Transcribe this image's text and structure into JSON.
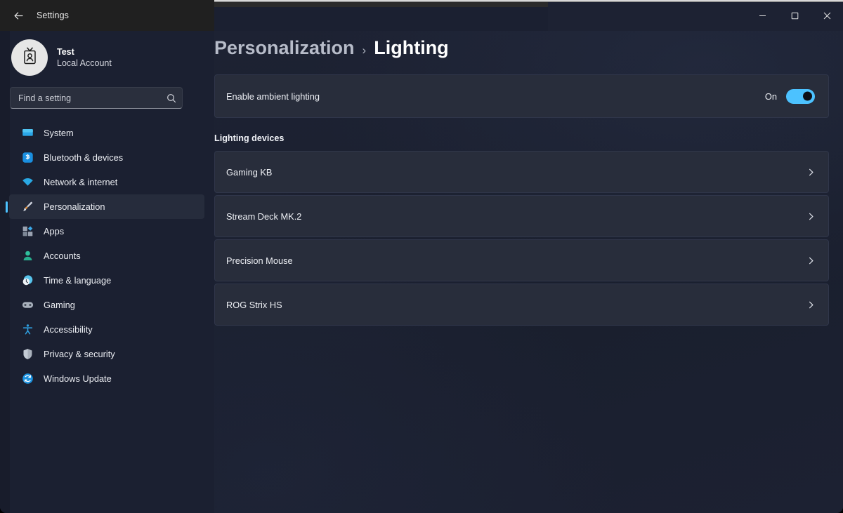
{
  "window": {
    "title": "Settings",
    "back_icon": "arrow-left-icon",
    "caption": {
      "minimize_label": "Minimize",
      "maximize_label": "Maximize",
      "close_label": "Close"
    }
  },
  "account": {
    "name": "Test",
    "type": "Local Account",
    "avatar_icon": "account-badge-icon"
  },
  "search": {
    "placeholder": "Find a setting",
    "value": "",
    "icon": "search-icon"
  },
  "sidebar": {
    "items": [
      {
        "label": "System",
        "icon": "monitor-icon",
        "selected": false
      },
      {
        "label": "Bluetooth & devices",
        "icon": "bluetooth-icon",
        "selected": false
      },
      {
        "label": "Network & internet",
        "icon": "wifi-icon",
        "selected": false
      },
      {
        "label": "Personalization",
        "icon": "paintbrush-icon",
        "selected": true
      },
      {
        "label": "Apps",
        "icon": "apps-icon",
        "selected": false
      },
      {
        "label": "Accounts",
        "icon": "person-icon",
        "selected": false
      },
      {
        "label": "Time & language",
        "icon": "clock-globe-icon",
        "selected": false
      },
      {
        "label": "Gaming",
        "icon": "gamepad-icon",
        "selected": false
      },
      {
        "label": "Accessibility",
        "icon": "accessibility-icon",
        "selected": false
      },
      {
        "label": "Privacy & security",
        "icon": "shield-icon",
        "selected": false
      },
      {
        "label": "Windows Update",
        "icon": "update-icon",
        "selected": false
      }
    ]
  },
  "breadcrumb": {
    "root": "Personalization",
    "separator": "›",
    "current": "Lighting"
  },
  "ambient_lighting": {
    "label": "Enable ambient lighting",
    "state_label": "On",
    "enabled": true
  },
  "devices_section": {
    "heading": "Lighting devices",
    "chevron_icon": "chevron-right-icon",
    "items": [
      {
        "name": "Gaming KB"
      },
      {
        "name": "Stream Deck MK.2"
      },
      {
        "name": "Precision Mouse"
      },
      {
        "name": "ROG Strix HS"
      }
    ]
  },
  "colors": {
    "accent": "#4cc2ff",
    "window_bg": "#1b2031",
    "card_bg": "#282d3b",
    "titlebar_bg": "#202020"
  }
}
